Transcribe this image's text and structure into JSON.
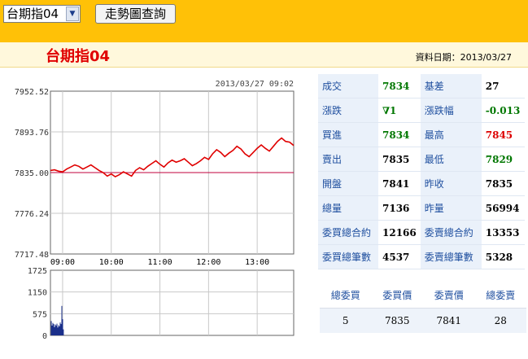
{
  "toolbar": {
    "select_value": "台期指04",
    "query_button": "走勢圖查詢"
  },
  "header": {
    "title": "台期指04",
    "date_label": "資料日期：2013/03/27"
  },
  "chart_data": [
    {
      "type": "line",
      "title": "2013/03/27 09:02",
      "yticks": [
        "7952.52",
        "7893.76",
        "7835.00",
        "7776.24",
        "7717.48"
      ],
      "ylim": [
        7717.48,
        7952.52
      ],
      "xticks": [
        "09:00",
        "10:00",
        "11:00",
        "12:00",
        "13:00"
      ],
      "reference_line": 7835.0,
      "series": [
        {
          "x": [
            "08:45",
            "08:50",
            "08:55",
            "09:00",
            "09:05",
            "09:10",
            "09:15",
            "09:20",
            "09:25",
            "09:30",
            "09:35",
            "09:40",
            "09:45",
            "09:50",
            "09:55",
            "10:00",
            "10:05",
            "10:10",
            "10:15",
            "10:20",
            "10:25",
            "10:30",
            "10:35",
            "10:40",
            "10:45",
            "10:50",
            "10:55",
            "11:00",
            "11:05",
            "11:10",
            "11:15",
            "11:20",
            "11:25",
            "11:30",
            "11:35",
            "11:40",
            "11:45",
            "11:50",
            "11:55",
            "12:00",
            "12:05",
            "12:10",
            "12:15",
            "12:20",
            "12:25",
            "12:30",
            "12:35",
            "12:40",
            "12:45",
            "12:50",
            "12:55",
            "13:00",
            "13:05",
            "13:10",
            "13:15",
            "13:20",
            "13:25",
            "13:30",
            "13:35",
            "13:40",
            "13:45"
          ],
          "values": [
            7838,
            7839,
            7837,
            7836,
            7840,
            7843,
            7846,
            7844,
            7840,
            7843,
            7846,
            7842,
            7838,
            7835,
            7830,
            7833,
            7829,
            7832,
            7836,
            7833,
            7830,
            7838,
            7842,
            7839,
            7844,
            7848,
            7852,
            7847,
            7843,
            7849,
            7853,
            7850,
            7852,
            7855,
            7850,
            7845,
            7848,
            7852,
            7857,
            7854,
            7862,
            7868,
            7864,
            7858,
            7863,
            7867,
            7873,
            7869,
            7862,
            7858,
            7864,
            7870,
            7875,
            7870,
            7866,
            7873,
            7880,
            7885,
            7880,
            7879,
            7874
          ]
        }
      ]
    },
    {
      "type": "bar",
      "yticks": [
        "1725",
        "1150",
        "575",
        "0"
      ],
      "ylim": [
        0,
        1725
      ],
      "xticks": [
        "09:00",
        "10:00",
        "11:00",
        "12:00",
        "13:00"
      ],
      "series": [
        {
          "x": [
            "08:46",
            "08:47",
            "08:48",
            "08:49",
            "08:50",
            "08:51",
            "08:52",
            "08:53",
            "08:54",
            "08:55",
            "08:56",
            "08:57",
            "08:58",
            "08:59",
            "09:00",
            "09:01"
          ],
          "values": [
            380,
            260,
            330,
            300,
            220,
            290,
            260,
            310,
            210,
            270,
            240,
            340,
            300,
            780,
            430,
            160
          ]
        }
      ]
    }
  ],
  "quote": {
    "rows": [
      [
        {
          "label": "成交",
          "value": "7834",
          "color": "green"
        },
        {
          "label": "基差",
          "value": "27",
          "color": "black"
        }
      ],
      [
        {
          "label": "漲跌",
          "value": "∇1",
          "color": "green"
        },
        {
          "label": "漲跌幅",
          "value": "-0.013",
          "color": "green"
        }
      ],
      [
        {
          "label": "買進",
          "value": "7834",
          "color": "green"
        },
        {
          "label": "最高",
          "value": "7845",
          "color": "red"
        }
      ],
      [
        {
          "label": "賣出",
          "value": "7835",
          "color": "black"
        },
        {
          "label": "最低",
          "value": "7829",
          "color": "green"
        }
      ],
      [
        {
          "label": "開盤",
          "value": "7841",
          "color": "black"
        },
        {
          "label": "昨收",
          "value": "7835",
          "color": "black"
        }
      ],
      [
        {
          "label": "總量",
          "value": "7136",
          "color": "black"
        },
        {
          "label": "昨量",
          "value": "56994",
          "color": "black"
        }
      ],
      [
        {
          "label": "委買總合約",
          "value": "12166",
          "color": "black"
        },
        {
          "label": "委賣總合約",
          "value": "13353",
          "color": "black"
        }
      ],
      [
        {
          "label": "委買總筆數",
          "value": "4537",
          "color": "black"
        },
        {
          "label": "委賣總筆數",
          "value": "5328",
          "color": "black"
        }
      ]
    ]
  },
  "orderbook": {
    "headers": [
      "總委買",
      "委買價",
      "委賣價",
      "總委賣"
    ],
    "values": [
      "5",
      "7835",
      "7841",
      "28"
    ]
  }
}
